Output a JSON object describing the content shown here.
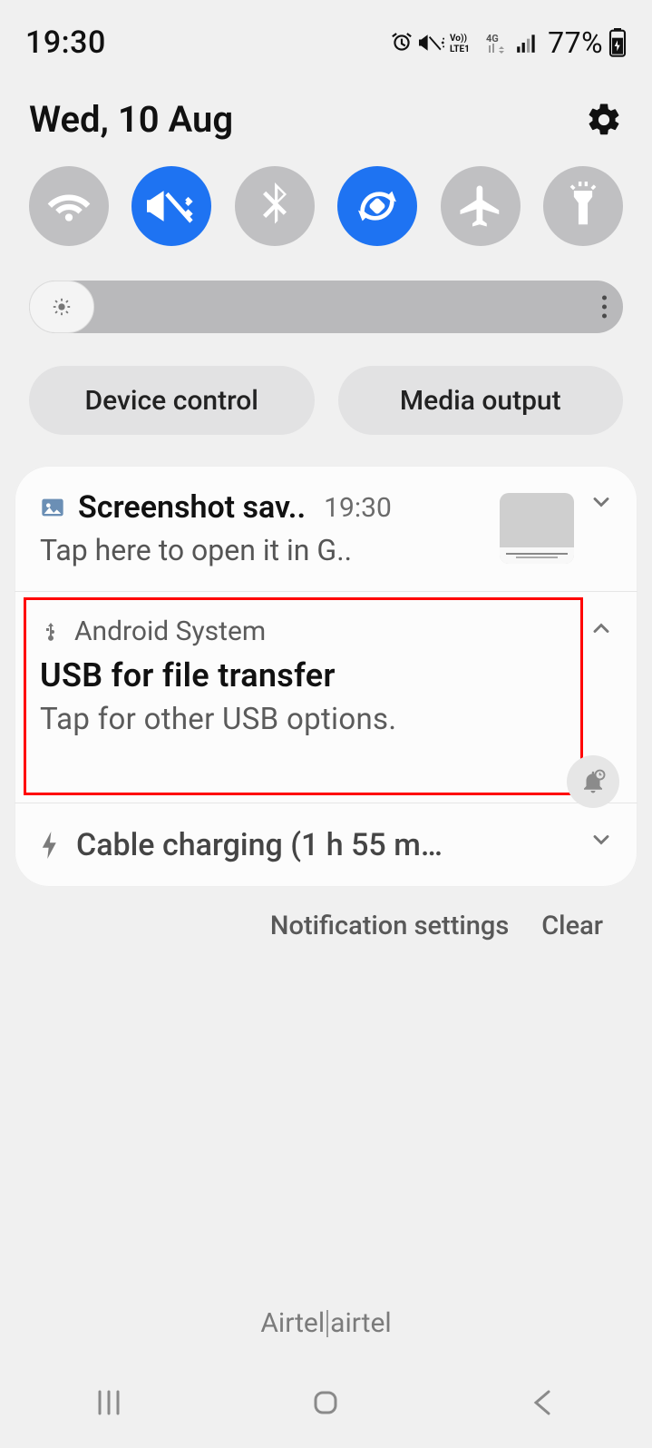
{
  "status": {
    "time": "19:30",
    "battery_percent": "77%"
  },
  "date": "Wed, 10 Aug",
  "qs": {
    "wifi_on": false,
    "sound_vibrate_on": true,
    "bluetooth_on": false,
    "rotate_on": true,
    "airplane_on": false,
    "torch_on": false
  },
  "pills": {
    "device_control": "Device control",
    "media_output": "Media output"
  },
  "notifications": {
    "screenshot": {
      "app": "Screenshot",
      "title": "Screenshot sav..",
      "time": "19:30",
      "body": "Tap here to open it in G.."
    },
    "usb": {
      "app": "Android System",
      "title": "USB for file transfer",
      "body": "Tap for other USB options."
    },
    "charging": {
      "title": "Cable charging (1 h 55 m…"
    }
  },
  "footer": {
    "settings": "Notification settings",
    "clear": "Clear"
  },
  "carrier": {
    "left": "Airtel",
    "right": "airtel"
  }
}
